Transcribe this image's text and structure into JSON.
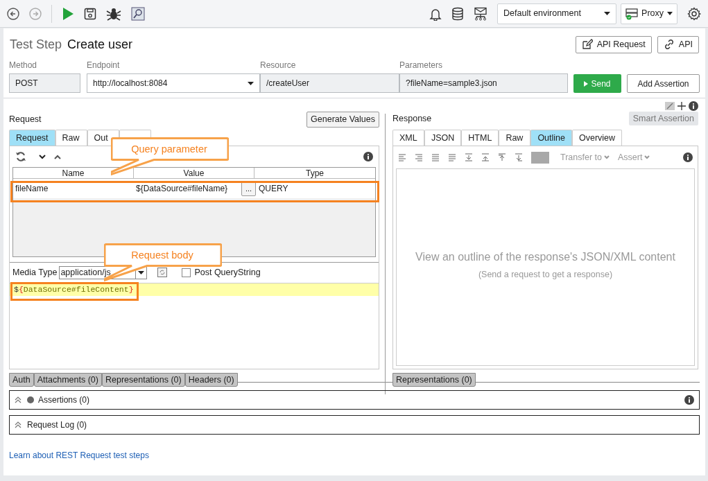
{
  "toolbar": {
    "environment": "Default environment",
    "proxy": "Proxy"
  },
  "test_step": {
    "label": "Test Step",
    "name": "Create user"
  },
  "header_buttons": [
    "API Request",
    "API"
  ],
  "fields": [
    {
      "label": "Method",
      "value": "POST",
      "kind": "text"
    },
    {
      "label": "Endpoint",
      "value": "http://localhost:8084",
      "kind": "dropdown"
    },
    {
      "label": "Resource",
      "value": "/createUser",
      "kind": "text"
    },
    {
      "label": "Parameters",
      "value": "?fileName=sample3.json",
      "kind": "text"
    }
  ],
  "send_button": "Send",
  "add_assertion_button": "Add Assertion",
  "request": {
    "title": "Request",
    "generate_button": "Generate Values",
    "tabs": [
      {
        "label": "Request",
        "selected": true
      },
      {
        "label": "Raw",
        "selected": false
      },
      {
        "label": "Out",
        "selected": false
      },
      {
        "selected": false
      }
    ],
    "params_table": {
      "columns": [
        "Name",
        "Value",
        "Type"
      ],
      "rows": [
        {
          "name": "fileName",
          "value": "${DataSource#fileName}",
          "button": "...",
          "type": "QUERY"
        }
      ]
    },
    "media_type": {
      "label": "Media Type",
      "value": "application/js"
    },
    "post_querystring": {
      "label": "Post QueryString",
      "checked": false
    },
    "body": [
      {
        "text": "$",
        "kind": "plain"
      },
      {
        "text": "{",
        "kind": "brace"
      },
      {
        "text": "DataSource#fileContent",
        "kind": "name"
      },
      {
        "text": "}",
        "kind": "brace"
      }
    ],
    "bottom_tabs": [
      "Auth",
      "Attachments (0)",
      "Representations (0)",
      "Headers (0)"
    ]
  },
  "response": {
    "title": "Response",
    "smart_assertion": "Smart Assertion",
    "tabs": [
      {
        "label": "XML",
        "selected": false
      },
      {
        "label": "JSON",
        "selected": false
      },
      {
        "label": "HTML",
        "selected": false
      },
      {
        "label": "Raw",
        "selected": false
      },
      {
        "label": "Outline",
        "selected": true
      },
      {
        "label": "Overview",
        "selected": false
      }
    ],
    "transfer": "Transfer to",
    "assert": "Assert",
    "empty_message": "View an outline of the response's JSON/XML content",
    "empty_hint": "(Send a request to get a response)",
    "bottom_tabs": [
      "Representations (0)"
    ]
  },
  "sections": [
    {
      "title": "Assertions (0)",
      "kind": "assertions"
    },
    {
      "title": "Request Log (0)",
      "kind": "log"
    }
  ],
  "link": "Learn about REST Request test steps",
  "callouts": [
    {
      "text": "Query parameter",
      "kind": "params"
    },
    {
      "text": "Request body",
      "kind": "body"
    }
  ]
}
